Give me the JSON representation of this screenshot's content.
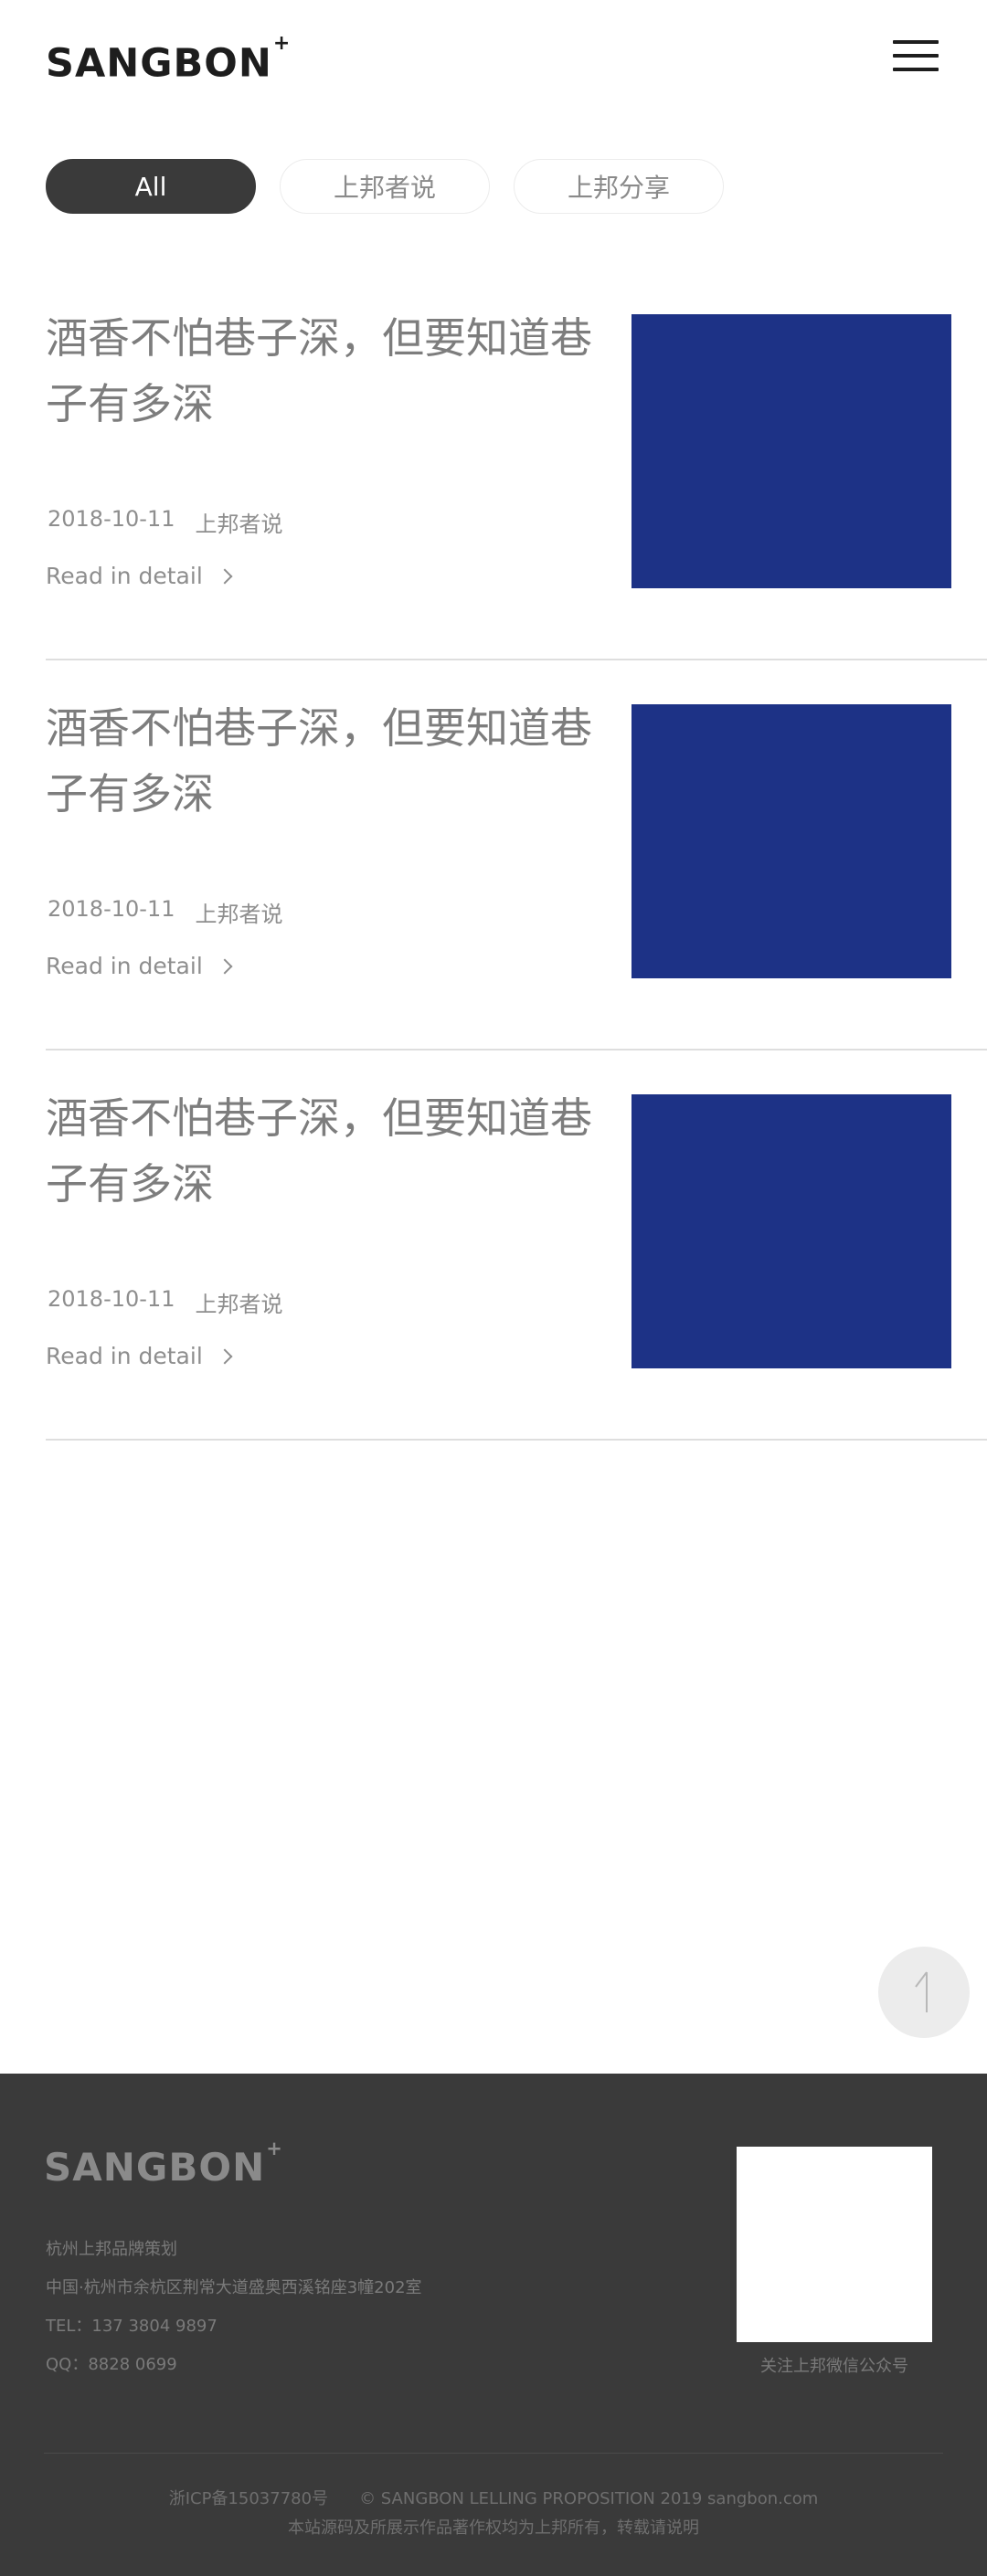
{
  "header": {
    "logo": "SANGBON",
    "logo_mark": "+",
    "menu_icon": "hamburger-menu-icon"
  },
  "tabs": [
    {
      "label": "All",
      "active": true
    },
    {
      "label": "上邦者说",
      "active": false
    },
    {
      "label": "上邦分享",
      "active": false
    }
  ],
  "articles": [
    {
      "title": "酒香不怕巷子深，但要知道巷子有多深",
      "date": "2018-10-11",
      "category": "上邦者说",
      "link": "Read in detail",
      "thumb_color": "#1d3286"
    },
    {
      "title": "酒香不怕巷子深，但要知道巷子有多深",
      "date": "2018-10-11",
      "category": "上邦者说",
      "link": "Read in detail",
      "thumb_color": "#1d3286"
    },
    {
      "title": "酒香不怕巷子深，但要知道巷子有多深",
      "date": "2018-10-11",
      "category": "上邦者说",
      "link": "Read in detail",
      "thumb_color": "#1d3286"
    }
  ],
  "back_to_top": {
    "icon": "arrow-up-icon"
  },
  "footer": {
    "logo": "SANGBON",
    "logo_mark": "+",
    "company": "杭州上邦品牌策划",
    "address": "中国·杭州市余杭区荆常大道盛奥西溪铭座3幢202室",
    "tel": "TEL：137 3804 9897",
    "qq": "QQ：8828 0699",
    "qr_caption": "关注上邦微信公众号",
    "icp": "浙ICP备15037780号",
    "copyright": "© SANGBON LELLING PROPOSITION 2019  sangbon.com",
    "notice": "本站源码及所展示作品著作权均为上邦所有，转载请说明"
  },
  "colors": {
    "accent_dark": "#3a3a3a",
    "thumb_blue": "#1d3286",
    "footer_bg": "#3a3a3a"
  }
}
